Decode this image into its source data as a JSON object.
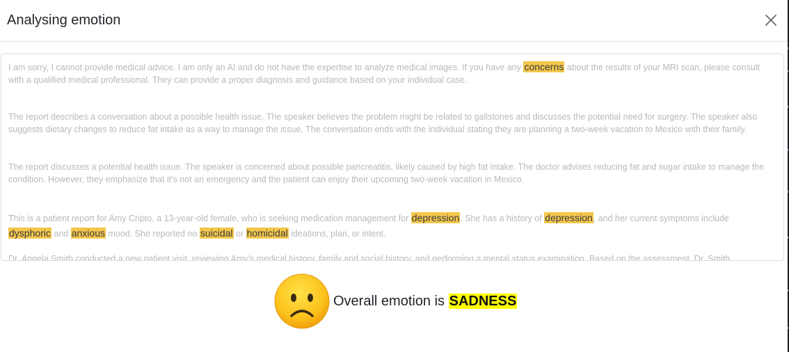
{
  "header": {
    "title": "Analysing emotion",
    "close_label": "Close"
  },
  "paragraphs": [
    {
      "segments": [
        {
          "text": "I am sorry, I cannot provide medical advice. I am only an AI and do not have the expertise to analyze medical images. If you have any ",
          "highlight": false
        },
        {
          "text": "concerns",
          "highlight": true
        },
        {
          "text": " about the results of your MRI scan, please consult with a qualified medical professional. They can provide a proper diagnosis and guidance based on your individual case.",
          "highlight": false
        }
      ]
    },
    {
      "segments": [
        {
          "text": "The report describes a conversation about a possible health issue. The speaker believes the problem might be related to gallstones and discusses the potential need for surgery. The speaker also suggests dietary changes to reduce fat intake as a way to manage the issue. The conversation ends with the individual stating they are planning a two-week vacation to Mexico with their family.",
          "highlight": false
        }
      ]
    },
    {
      "segments": [
        {
          "text": "The report discusses a potential health issue. The speaker is concerned about possible pancreatitis, likely caused by high fat intake. The doctor advises reducing fat and sugar intake to manage the condition. However, they emphasize that it's not an emergency and the patient can enjoy their upcoming two-week vacation in Mexico.",
          "highlight": false
        }
      ]
    },
    {
      "segments": [
        {
          "text": "This is a patient report for Amy Cripto, a 13-year-old female, who is seeking medication management for ",
          "highlight": false
        },
        {
          "text": "depression",
          "highlight": true
        },
        {
          "text": ". She has a history of ",
          "highlight": false
        },
        {
          "text": "depression",
          "highlight": true
        },
        {
          "text": ", and her current symptoms include ",
          "highlight": false
        },
        {
          "text": "dysphoric",
          "highlight": true
        },
        {
          "text": " and ",
          "highlight": false
        },
        {
          "text": "anxious",
          "highlight": true
        },
        {
          "text": " mood. She reported no ",
          "highlight": false
        },
        {
          "text": "suicidal",
          "highlight": true
        },
        {
          "text": " or ",
          "highlight": false
        },
        {
          "text": "homicidal",
          "highlight": true
        },
        {
          "text": " ideations, plan, or intent.",
          "highlight": false
        }
      ]
    },
    {
      "segments": [
        {
          "text": "Dr. Angela Smith conducted a new patient visit, reviewing Amy's medical history, family and social history, and performing a mental status examination. Based on the assessment, Dr. Smith",
          "highlight": false
        }
      ]
    }
  ],
  "result": {
    "prefix": "Overall emotion is ",
    "emotion": "SADNESS",
    "emoji_icon": "sad-face-emoji-icon"
  },
  "colors": {
    "highlight": "#f3c74d",
    "emotion_highlight": "#ffff00"
  }
}
